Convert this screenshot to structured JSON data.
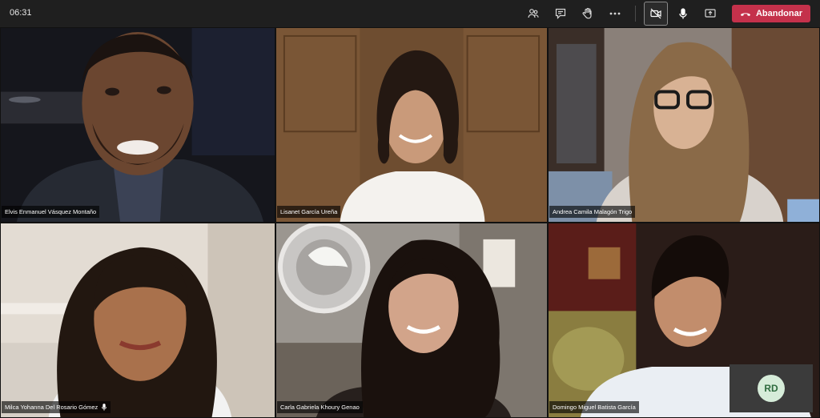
{
  "call": {
    "timer": "06:31",
    "leave_label": "Abandonar"
  },
  "toolbar": {
    "icons": [
      "participants-icon",
      "chat-icon",
      "raise-hand-icon",
      "more-icon",
      "camera-off-icon",
      "microphone-icon",
      "share-screen-icon",
      "hang-up-icon"
    ]
  },
  "participants": [
    {
      "name": "Elvis Enmanuel Vásquez Montaño"
    },
    {
      "name": "Lisanet García Ureña"
    },
    {
      "name": "Andrea Camila Malagón Trigo"
    },
    {
      "name": "Milca Yohanna Del Rosario Gómez"
    },
    {
      "name": "Carla Gabriela Khoury Genao"
    },
    {
      "name": "Domingo Miguel Batista García"
    }
  ],
  "self_preview": {
    "initials": "RD"
  },
  "colors": {
    "leave": "#c4314b",
    "bar": "#1f1f1f",
    "avatar_bg": "#d6ecd9",
    "avatar_fg": "#2e6b3e"
  }
}
